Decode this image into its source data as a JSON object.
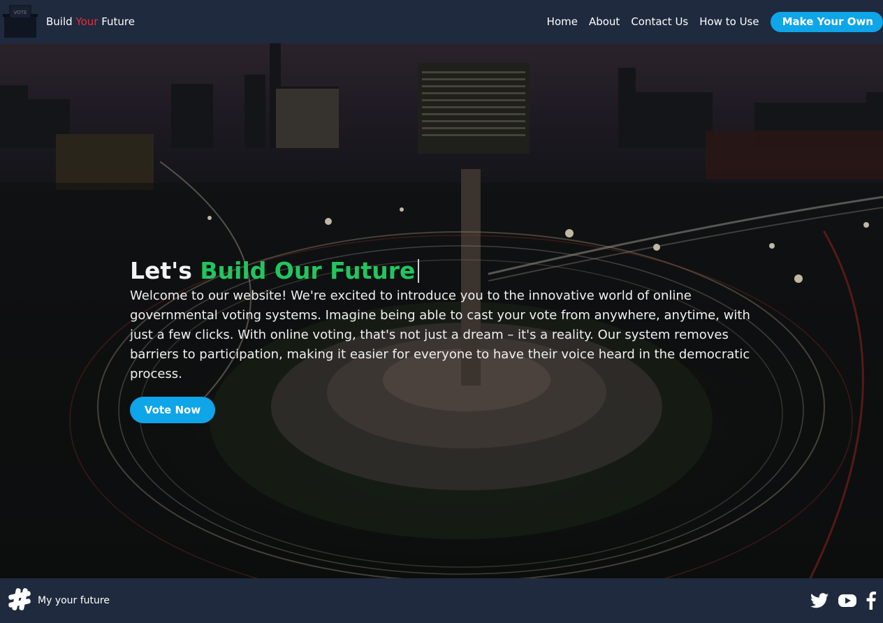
{
  "header": {
    "logo_icon": "ballot-box-icon",
    "logo_text": "VOTE",
    "brand": {
      "part1": "Build ",
      "part2": "Your",
      "part3": " Future"
    },
    "nav": [
      {
        "label": "Home"
      },
      {
        "label": "About"
      },
      {
        "label": "Contact Us"
      },
      {
        "label": "How to Use"
      }
    ],
    "cta": "Make Your Own"
  },
  "hero": {
    "headline_prefix": "Let's ",
    "headline_highlight": "Build Our Future",
    "intro": "Welcome to our website! We're excited to introduce you to the innovative world of online governmental voting systems. Imagine being able to cast your vote from anywhere, anytime, with just a few clicks. With online voting, that's not just a dream – it's a reality. Our system removes barriers to participation, making it easier for everyone to have their voice heard in the democratic process.",
    "button": "Vote Now",
    "background": "city-roundabout-night-photo"
  },
  "footer": {
    "icon": "hashtag-icon",
    "text": "My your future",
    "socials": [
      {
        "icon": "twitter-icon"
      },
      {
        "icon": "youtube-icon"
      },
      {
        "icon": "facebook-icon"
      }
    ]
  },
  "colors": {
    "header_bg": "#1f2a3e",
    "accent_blue": "#0ea5e9",
    "accent_red": "#e0313a",
    "headline_green": "#22c55e"
  }
}
